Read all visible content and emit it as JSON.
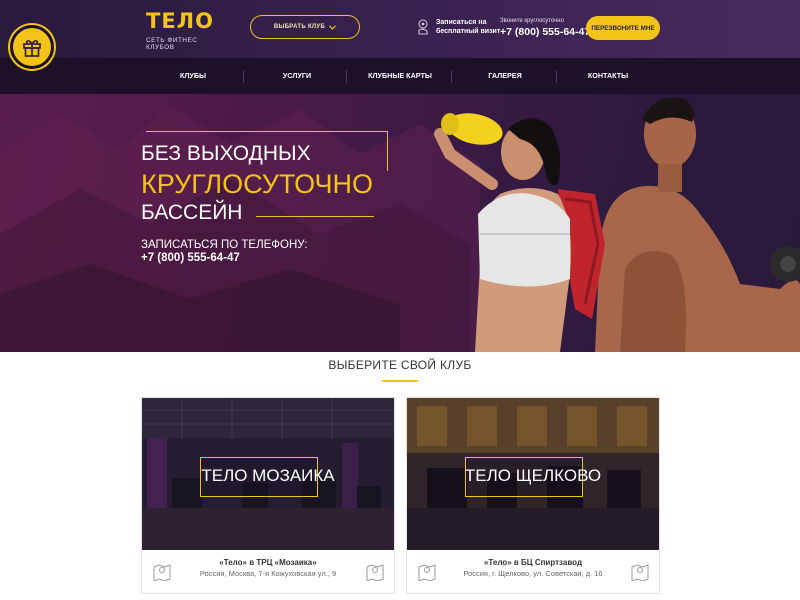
{
  "header": {
    "logo": "ТЕЛО",
    "logo_subtitle": "СЕТЬ ФИТНЕС КЛУБОВ",
    "choose_club_label": "ВЫБРАТЬ КЛУБ",
    "signup_text": "Записаться на бесплатный визит",
    "phone_caption": "Звоните круглосуточно",
    "phone": "+7 (800) 555-64-47",
    "callback_label": "ПЕРЕЗВОНИТЕ МНЕ"
  },
  "nav": {
    "items": [
      {
        "label": "КЛУБЫ"
      },
      {
        "label": "УСЛУГИ"
      },
      {
        "label": "КЛУБНЫЕ КАРТЫ"
      },
      {
        "label": "ГАЛЕРЕЯ"
      },
      {
        "label": "КОНТАКТЫ"
      }
    ]
  },
  "hero": {
    "line1": "БЕЗ ВЫХОДНЫХ",
    "line2": "КРУГЛОСУТОЧНО",
    "line3": "БАССЕЙН",
    "cta_label": "ЗАПИСАТЬСЯ ПО ТЕЛЕФОНУ:",
    "cta_phone": "+7 (800) 555-64-47"
  },
  "clubs": {
    "section_title": "ВЫБЕРИТЕ СВОЙ КЛУБ",
    "cards": [
      {
        "name": "ТЕЛО МОЗАИКА",
        "title": "«Тело» в ТРЦ «Мозаика»",
        "address": "Россия, Москва, 7-я Кожуховская ул., 9"
      },
      {
        "name": "ТЕЛО ЩЕЛКОВО",
        "title": "«Тело» в БЦ Спиртзавод",
        "address": "Россия, г. Щелково, ул. Советская, д. 16"
      }
    ]
  },
  "colors": {
    "accent": "#f2c418",
    "header_bg": "#2a1a3c",
    "nav_bg": "#1c1128",
    "hero_bg": "#4c1a48"
  }
}
